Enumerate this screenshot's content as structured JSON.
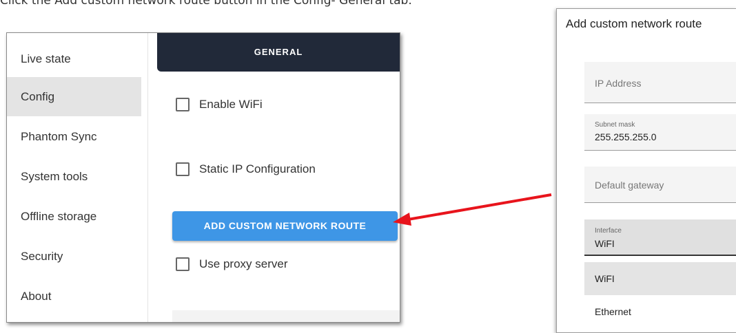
{
  "instruction": "Click the Add custom network route button in the Config- General tab.",
  "sidebar": {
    "items": [
      {
        "label": "Live state",
        "active": false
      },
      {
        "label": "Config",
        "active": true
      },
      {
        "label": "Phantom Sync",
        "active": false
      },
      {
        "label": "System tools",
        "active": false
      },
      {
        "label": "Offline storage",
        "active": false
      },
      {
        "label": "Security",
        "active": false
      },
      {
        "label": "About",
        "active": false
      }
    ]
  },
  "tabs": {
    "active_label": "GENERAL"
  },
  "checkboxes": {
    "wifi": {
      "label": "Enable WiFi",
      "checked": false
    },
    "static_ip": {
      "label": "Static IP Configuration",
      "checked": false
    },
    "proxy": {
      "label": "Use proxy server",
      "checked": false
    }
  },
  "add_route_button": {
    "label": "ADD CUSTOM NETWORK ROUTE"
  },
  "dialog": {
    "title": "Add custom network route",
    "ip_address": {
      "placeholder": "IP Address"
    },
    "subnet_mask": {
      "label": "Subnet mask",
      "value": "255.255.255.0"
    },
    "default_gateway": {
      "placeholder": "Default gateway"
    },
    "interface": {
      "label": "Interface",
      "value": "WiFI"
    },
    "options": [
      "WiFI",
      "Ethernet"
    ]
  },
  "colors": {
    "tab_bar": "#212939",
    "button_blue": "#3e96e6",
    "arrow_red": "#e8141c",
    "active_item": "#e4e4e4"
  }
}
